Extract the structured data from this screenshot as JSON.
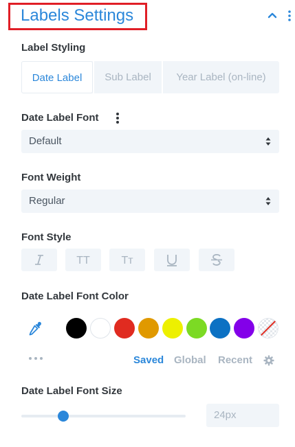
{
  "header": {
    "title": "Labels Settings"
  },
  "label_styling": {
    "label": "Label Styling",
    "tabs": [
      "Date Label",
      "Sub Label",
      "Year Label (on-line)"
    ],
    "active_tab": "Date Label"
  },
  "date_label_font": {
    "label": "Date Label Font",
    "value": "Default"
  },
  "font_weight": {
    "label": "Font Weight",
    "value": "Regular"
  },
  "font_style": {
    "label": "Font Style",
    "buttons": [
      "italic",
      "uppercase",
      "capitalize",
      "underline",
      "strikethrough"
    ],
    "uppercase_glyph": "TT",
    "capitalize_glyph": "Tт"
  },
  "font_color": {
    "label": "Date Label Font Color",
    "swatches": [
      "#000000",
      "#ffffff",
      "#e02b20",
      "#e09900",
      "#edf000",
      "#7cda24",
      "#0c71c3",
      "#8300e9",
      "none"
    ],
    "tabs": [
      "Saved",
      "Global",
      "Recent"
    ],
    "active_tab": "Saved"
  },
  "font_size": {
    "label": "Date Label Font Size",
    "value": "24px",
    "slider_fraction": 0.25
  },
  "colors": {
    "accent": "#2b87da",
    "highlight_border": "#e01e26"
  }
}
